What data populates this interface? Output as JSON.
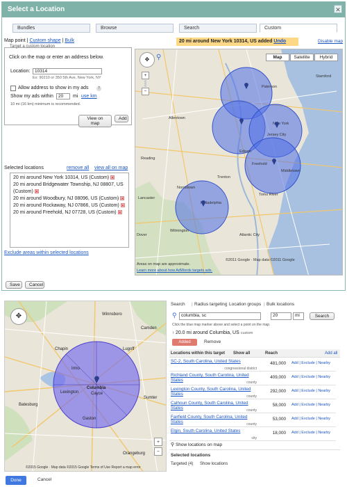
{
  "dialog": {
    "title": "Select a Location",
    "close": "✕",
    "tabs": [
      "Bundles",
      "Browse",
      "Search",
      "Custom"
    ],
    "banner": {
      "text": "20 mi around New York 10314, US added",
      "undo": "Undo"
    },
    "disable_map": "Disable map",
    "map_point": {
      "label": "Map point",
      "custom_shape": "Custom shape",
      "bulk": "Bulk",
      "note": "Target a custom location"
    },
    "instructions": "Click on the map or enter an address below.",
    "location_label": "Location:",
    "location_value": "10314",
    "location_example": "Ex: 90210 or 350 5th Ave, New York, NY",
    "allow_address": "Allow address to show in my ads",
    "show_ads_within": "Show my ads within",
    "radius_value": "20",
    "units": "mi",
    "use_km": "use km",
    "min_note": "10 mi (16 km) minimum is recommended.",
    "view_on_map": "View on map",
    "add": "Add",
    "selected_label": "Selected locations",
    "remove_all": "remove all",
    "view_all": "view all on map",
    "locations": [
      "20 mi around New York 10314, US (Custom)",
      "20 mi around Bridgewater Township, NJ 08807, US (Custom)",
      "20 mi around Woodbury, NJ 08096, US (Custom)",
      "20 mi around Rockaway, NJ 07866, US (Custom)",
      "20 mi around Freehold, NJ 07728, US (Custom)"
    ],
    "exclude": "Exclude areas within selected locations",
    "save": "Save",
    "cancel": "Cancel",
    "map": {
      "types": [
        "Map",
        "Satellite",
        "Hybrid"
      ],
      "attr1": "Areas on map are approximate.",
      "attr2": "Learn more about how AdWords targets ads.",
      "copyright": "©2011 Google · Map data ©2011 Google",
      "places": [
        "New York",
        "Jersey City",
        "Edison",
        "Trenton",
        "Philadelphia",
        "Allentown",
        "Reading",
        "Wilmington",
        "Toms River",
        "Dover",
        "Paterson",
        "Middletown",
        "Union",
        "Atlantic City",
        "Stamford",
        "Norristown",
        "Lancaster",
        "Freehold"
      ]
    }
  },
  "bottom": {
    "tabs": [
      "Search",
      "Radius targeting",
      "Location groups",
      "Bulk locations"
    ],
    "search_value": "columbia, sc",
    "radius": "20",
    "unit": "mi",
    "search_btn": "Search",
    "hint": "Click the blue map marker above and select a point on the map.",
    "added": "20.0 mi around Columbia, US",
    "added_tag": "custom",
    "added_btn": "Added",
    "remove": "Remove",
    "headers": {
      "loc": "Locations within this target",
      "show": "Show all",
      "reach": "Reach",
      "add_all": "Add all"
    },
    "rows": [
      {
        "name": "SC-2, South Carolina, United States",
        "type": "congressional district",
        "reach": "481,000"
      },
      {
        "name": "Richland County, South Carolina, United States",
        "type": "county",
        "reach": "409,000"
      },
      {
        "name": "Lexington County, South Carolina, United States",
        "type": "county",
        "reach": "292,000"
      },
      {
        "name": "Calhoun County, South Carolina, United States",
        "type": "county",
        "reach": "58,000"
      },
      {
        "name": "Fairfield County, South Carolina, United States",
        "type": "county",
        "reach": "53,000"
      },
      {
        "name": "Elgin, South Carolina, United States",
        "type": "city",
        "reach": "18,000"
      }
    ],
    "actions": "Add | Exclude | Nearby",
    "show_locs": "Show locations on map",
    "selected": "Selected locations",
    "targeted": "Targeted (4)",
    "show_locations": "Show locations",
    "map": {
      "places": [
        "Columbia",
        "Lexington",
        "Cayce",
        "Irmo",
        "Sumter",
        "Camden",
        "Orangeburg",
        "Chapin",
        "Batesburg",
        "Lugoff",
        "Winnsboro",
        "Gaston"
      ],
      "copyright": "©2015 Google · Map data ©2015 Google  Terms of Use  Report a map error"
    },
    "done": "Done",
    "cancel": "Cancel"
  }
}
